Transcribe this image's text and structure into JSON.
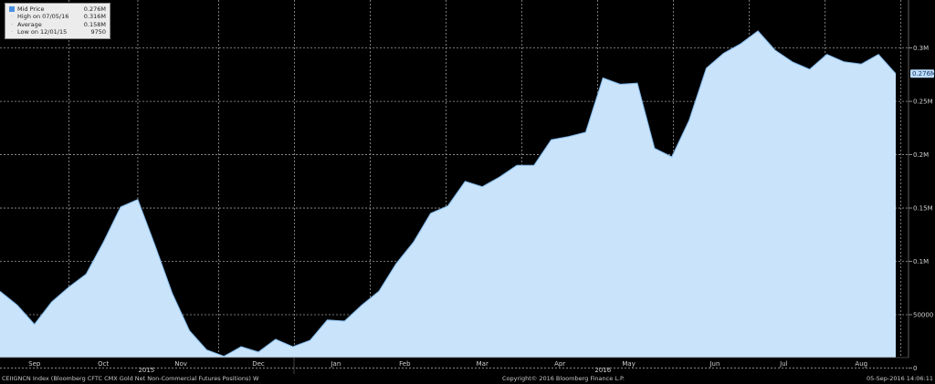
{
  "legend": {
    "rows": [
      {
        "label": "Mid Price",
        "value": "0.276M"
      },
      {
        "label": "High on 07/05/16",
        "value": "0.316M"
      },
      {
        "label": "Average",
        "value": "0.158M"
      },
      {
        "label": "Low on 12/01/15",
        "value": "9750"
      }
    ]
  },
  "footer": {
    "left": "CEIIGNCN Index (Bloomberg CFTC CMX Gold Net Non-Commercial Futures Positions)  W",
    "center": "Copyright© 2016 Bloomberg Finance L.P.",
    "right": "05-Sep-2016 14:06:11"
  },
  "last_label": "0.276M",
  "colors": {
    "fill": "#c9e3fb",
    "line": "#7fb6e8",
    "last_box": "#bcdcfa"
  },
  "chart_data": {
    "type": "area",
    "ylim": [
      -15000,
      345000
    ],
    "y_ticks": [
      {
        "v": 300000,
        "label": "0.3M"
      },
      {
        "v": 250000,
        "label": "0.25M"
      },
      {
        "v": 200000,
        "label": "0.2M"
      },
      {
        "v": 150000,
        "label": "0.15M"
      },
      {
        "v": 100000,
        "label": "0.1M"
      },
      {
        "v": 50000,
        "label": "50000"
      },
      {
        "v": 0,
        "label": "0"
      }
    ],
    "x_month_labels": [
      {
        "label": "Sep",
        "week": 2
      },
      {
        "label": "Oct",
        "week": 6
      },
      {
        "label": "Nov",
        "week": 10.5
      },
      {
        "label": "Dec",
        "week": 15
      },
      {
        "label": "Jan",
        "week": 19.5
      },
      {
        "label": "Feb",
        "week": 23.5
      },
      {
        "label": "Mar",
        "week": 28
      },
      {
        "label": "Apr",
        "week": 32.5
      },
      {
        "label": "May",
        "week": 36.5
      },
      {
        "label": "Jun",
        "week": 41.5
      },
      {
        "label": "Jul",
        "week": 45.5
      },
      {
        "label": "Aug",
        "week": 50
      }
    ],
    "x_year_labels": [
      {
        "label": "2015",
        "week": 8.5
      },
      {
        "label": "2016",
        "week": 35
      }
    ],
    "grid_weeks": [
      4,
      8,
      12.7,
      17.1,
      21.5,
      25.9,
      30.3,
      34.7,
      39.1,
      43.5,
      47.9,
      52.3
    ],
    "series": [
      {
        "values": [
          72000,
          59000,
          41000,
          62000,
          76000,
          88000,
          118000,
          151000,
          158000,
          115000,
          70000,
          35000,
          17000,
          11000,
          20000,
          15000,
          27000,
          20000,
          26000,
          45000,
          44000,
          59000,
          72000,
          98000,
          118000,
          145000,
          152000,
          175000,
          170000,
          179000,
          190000,
          190000,
          214000,
          217000,
          221000,
          272000,
          266000,
          267000,
          206000,
          198000,
          232000,
          281000,
          295000,
          304000,
          316000,
          298000,
          287000,
          280000,
          294000,
          287000,
          285000,
          294000,
          276000
        ]
      }
    ]
  }
}
